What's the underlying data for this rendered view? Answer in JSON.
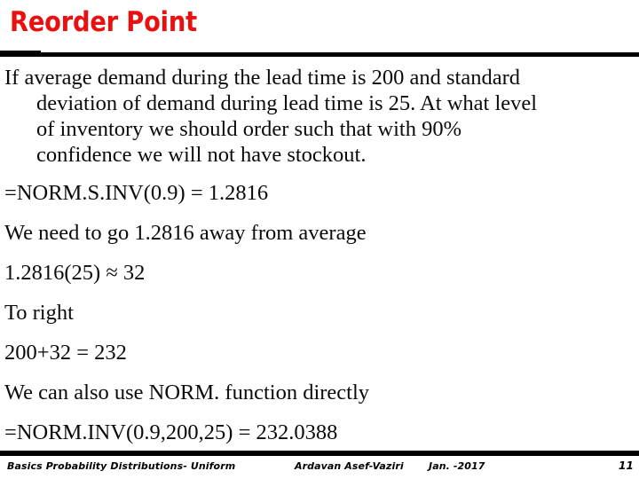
{
  "slide": {
    "title": "Reorder Point",
    "accent_color": "#EB1010",
    "rule_color": "#000000",
    "background_color": "#FFFFFF",
    "body": {
      "intro_lines": [
        "If average demand during the lead time is 200 and standard",
        "deviation of demand during lead time is 25.  At what level",
        "of inventory we should order such that with 90%",
        "confidence we will not have stockout."
      ],
      "lines": [
        "=NORM.S.INV(0.9) = 1.2816",
        "We need to go 1.2816 away from average",
        "1.2816(25) ≈ 32",
        "To right",
        "200+32 = 232",
        "We can also use NORM. function directly",
        "=NORM.INV(0.9,200,25) =  232.0388"
      ]
    }
  },
  "footer": {
    "course": "Basics Probability Distributions- Uniform",
    "author": "Ardavan Asef-Vaziri",
    "date": "Jan. -2017",
    "page_number": "11"
  }
}
